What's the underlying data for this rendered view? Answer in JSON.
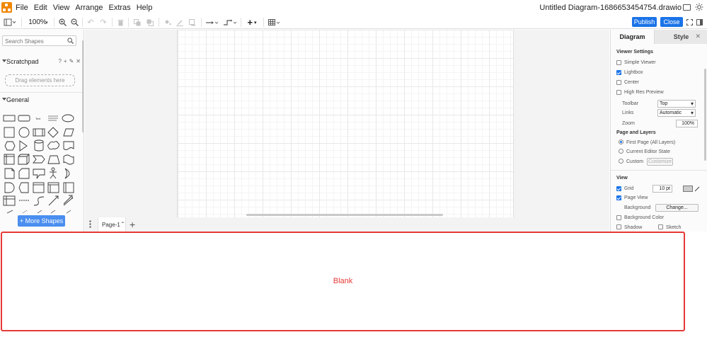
{
  "menubar": {
    "items": [
      "File",
      "Edit",
      "View",
      "Arrange",
      "Extras",
      "Help"
    ],
    "document_title": "Untitled Diagram-1686653454754.drawio"
  },
  "toolbar": {
    "zoom": "100%",
    "publish_label": "Publish",
    "close_label": "Close"
  },
  "sidebar": {
    "search_placeholder": "Search Shapes",
    "scratchpad_title": "Scratchpad",
    "scratchpad_tools": [
      "?",
      "+",
      "✎",
      "✕"
    ],
    "scratchpad_drop_text": "Drag elements here",
    "general_title": "General",
    "more_shapes_label": "+ More Shapes"
  },
  "pages": {
    "current_tab": "Page-1"
  },
  "format_panel": {
    "tabs": [
      "Diagram",
      "Style"
    ],
    "viewer_settings_title": "Viewer Settings",
    "simple_viewer": {
      "label": "Simple Viewer",
      "checked": false
    },
    "lightbox": {
      "label": "Lightbox",
      "checked": true
    },
    "center": {
      "label": "Center",
      "checked": false
    },
    "high_res_preview": {
      "label": "High Res Preview",
      "checked": false
    },
    "toolbar_label": "Toolbar",
    "toolbar_value": "Top",
    "links_label": "Links",
    "links_value": "Automatic",
    "zoom_label": "Zoom",
    "zoom_value": "100%",
    "page_layers_title": "Page and Layers",
    "first_page": "First Page (All Layers)",
    "current_editor_state": "Current Editor State",
    "custom": "Custom",
    "customize_label": "Customize",
    "view_title": "View",
    "grid_label": "Grid",
    "grid_size": "10 pt",
    "page_view_label": "Page View",
    "background_label": "Background",
    "change_label": "Change...",
    "background_color_label": "Background Color",
    "shadow_label": "Shadow",
    "sketch_label": "Sketch"
  },
  "blank_region": {
    "label": "Blank"
  },
  "colors": {
    "accent": "#1a73e8",
    "logo": "#f08705",
    "blank_border": "#e53935"
  }
}
